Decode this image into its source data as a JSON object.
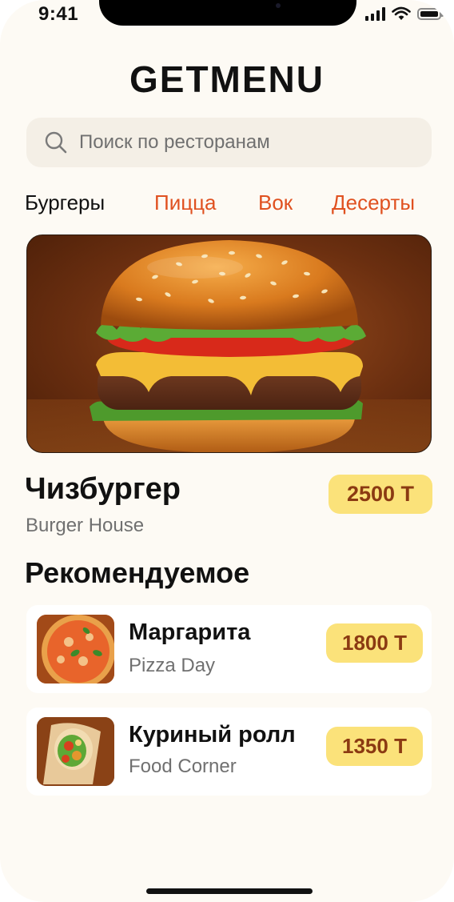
{
  "status_bar": {
    "time": "9:41"
  },
  "app": {
    "title": "GETMENU"
  },
  "search": {
    "placeholder": "Поиск по ресторанам",
    "value": ""
  },
  "tabs": [
    {
      "label": "Бургеры",
      "active": true
    },
    {
      "label": "Пицца",
      "active": false
    },
    {
      "label": "Вок",
      "active": false
    },
    {
      "label": "Десерты",
      "active": false
    }
  ],
  "featured": {
    "name": "Чизбургер",
    "restaurant": "Burger House",
    "price": "2500 Т"
  },
  "recommended": {
    "title": "Рекомендуемое",
    "items": [
      {
        "name": "Маргарита",
        "restaurant": "Pizza Day",
        "price": "1800 Т"
      },
      {
        "name": "Куриный ролл",
        "restaurant": "Food Corner",
        "price": "1350 Т"
      }
    ]
  },
  "colors": {
    "accent": "#e05120",
    "price_bg": "#fbe27a",
    "price_text": "#8b3a12",
    "background": "#fdfaf4",
    "search_bg": "#f4efe6"
  }
}
